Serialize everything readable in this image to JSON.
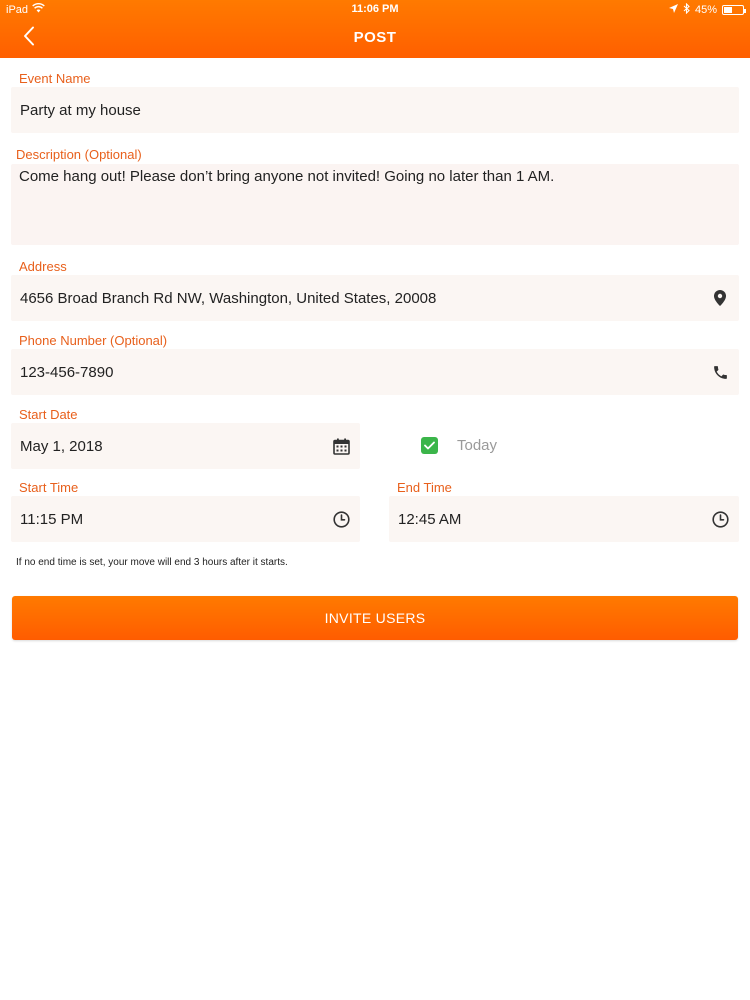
{
  "status_bar": {
    "device": "iPad",
    "time": "11:06 PM",
    "battery": "45%",
    "battery_level": 0.45
  },
  "nav": {
    "title": "POST",
    "back_icon": "chevron-left-icon"
  },
  "form": {
    "event_name": {
      "label": "Event Name",
      "value": "Party at my house"
    },
    "description": {
      "label": "Description (Optional)",
      "value": "Come hang out! Please don’t bring anyone not invited! Going no later than 1 AM."
    },
    "address": {
      "label": "Address",
      "value": "4656 Broad Branch Rd NW, Washington, United States, 20008",
      "icon": "map-pin-icon"
    },
    "phone": {
      "label": "Phone Number (Optional)",
      "value": "123-456-7890",
      "icon": "phone-icon"
    },
    "start_date": {
      "label": "Start Date",
      "value": "May 1, 2018",
      "icon": "calendar-icon"
    },
    "today": {
      "label": "Today",
      "checked": true
    },
    "start_time": {
      "label": "Start Time",
      "value": "11:15 PM",
      "icon": "clock-icon"
    },
    "end_time": {
      "label": "End Time",
      "value": "12:45 AM",
      "icon": "clock-icon"
    },
    "hint": "If no end time is set, your move will end 3 hours after it starts."
  },
  "actions": {
    "invite_label": "INVITE USERS"
  },
  "colors": {
    "accent": "#ff6a00",
    "label": "#e8601c",
    "field_bg": "#fbf6f3",
    "checkbox": "#3bb54a"
  }
}
